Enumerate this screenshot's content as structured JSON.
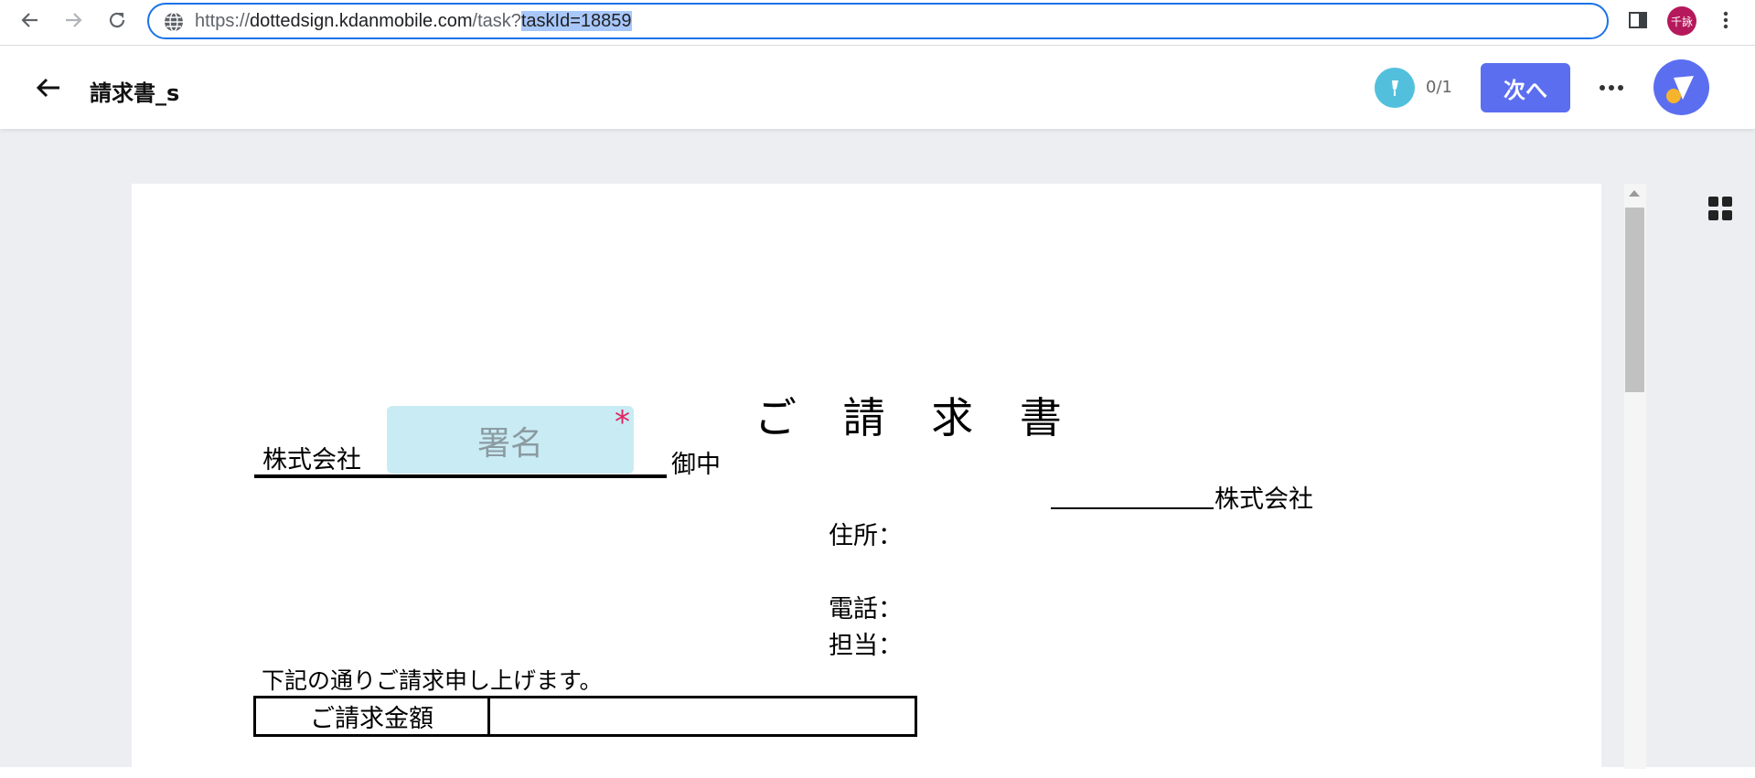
{
  "browser": {
    "url_scheme": "https://",
    "url_host": "dottedsign.kdanmobile.com",
    "url_path": "/task?",
    "url_selected": "taskId=18859",
    "profile_label": "千詠"
  },
  "header": {
    "title": "請求書_s",
    "signature_progress": "0/1",
    "next_label": "次へ"
  },
  "document": {
    "heading": "ご 請 求 書",
    "company_left": "株式会社",
    "signature_field_label": "署名",
    "signature_required_mark": "*",
    "onchu": "御中",
    "our_company": "株式会社",
    "address_label": "住所：",
    "phone_label": "電話：",
    "person_label": "担当：",
    "note": "下記の通りご請求申し上げます。",
    "amount_label": "ご請求金額"
  },
  "colors": {
    "accent": "#5b6ef0",
    "signature_icon": "#52c0dd",
    "signature_field": "#c9ebf4",
    "required": "#e0245e",
    "profile": "#b5195b"
  },
  "icons": {
    "back": "back-arrow-icon",
    "forward": "forward-arrow-icon",
    "reload": "reload-icon",
    "site_info": "globe-icon",
    "side_panel": "side-panel-icon",
    "browser_menu": "kebab-menu-icon",
    "pen": "pen-icon",
    "more": "more-dots-icon",
    "thumbnails": "grid-icon"
  }
}
